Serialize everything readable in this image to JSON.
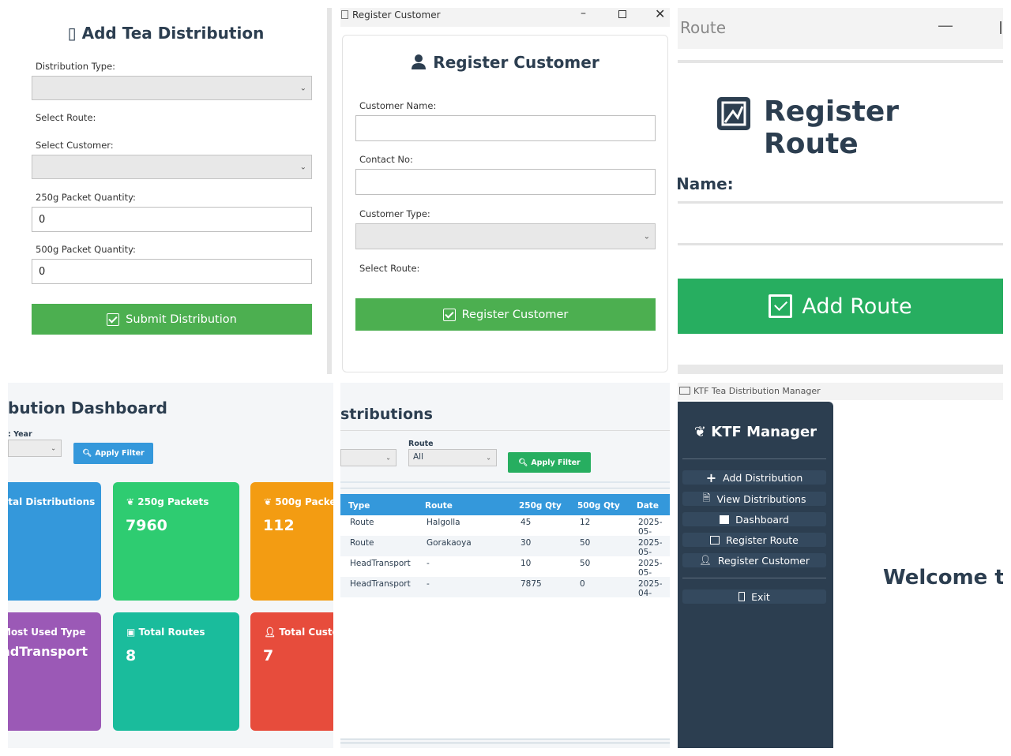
{
  "add_distribution": {
    "title": "Add Tea Distribution",
    "title_glyph": "▯",
    "distribution_type_label": "Distribution Type:",
    "distribution_type_value": "",
    "select_route_label": "Select Route:",
    "select_customer_label": "Select Customer:",
    "select_customer_value": "",
    "qty250_label": "250g Packet Quantity:",
    "qty250_value": "0",
    "qty500_label": "500g Packet Quantity:",
    "qty500_value": "0",
    "submit_label": "Submit Distribution"
  },
  "register_customer": {
    "window_title": "Register Customer",
    "title": "Register Customer",
    "customer_name_label": "Customer Name:",
    "customer_name_value": "",
    "contact_label": "Contact No:",
    "contact_value": "",
    "customer_type_label": "Customer Type:",
    "customer_type_value": "",
    "select_route_label": "Select Route:",
    "submit_label": "Register Customer"
  },
  "register_route": {
    "window_title": "Route",
    "title": "Register Route",
    "name_label": "Name:",
    "name_value": "",
    "submit_label": "Add Route"
  },
  "dashboard": {
    "title": "bution Dashboard",
    "year_label": ": Year",
    "year_value": "",
    "apply_filter_label": "Apply Filter",
    "cards": [
      {
        "title": "otal Distributions",
        "value": "",
        "color": "#3498db"
      },
      {
        "title": "250g Packets",
        "value": "7960",
        "color": "#2ecc71"
      },
      {
        "title": "500g Packe",
        "value": "112",
        "color": "#f39c12"
      },
      {
        "title": "Most Used Type",
        "value": "adTransport",
        "color": "#9b59b6"
      },
      {
        "title": "Total Routes",
        "value": "8",
        "color": "#1abc9c"
      },
      {
        "title": "Total Custo",
        "value": "7",
        "color": "#e74c3c"
      }
    ]
  },
  "distributions": {
    "title": "stributions",
    "first_filter_value": "",
    "route_label": "Route",
    "route_value": "All",
    "apply_filter_label": "Apply Filter",
    "columns": [
      "Type",
      "Route",
      "250g Qty",
      "500g Qty",
      "Date"
    ],
    "rows": [
      [
        "Route",
        "Halgolla",
        "45",
        "12",
        "2025-05-"
      ],
      [
        "Route",
        "Gorakaoya",
        "30",
        "50",
        "2025-05-"
      ],
      [
        "HeadTransport",
        "-",
        "10",
        "50",
        "2025-05-"
      ],
      [
        "HeadTransport",
        "-",
        "7875",
        "0",
        "2025-04-"
      ]
    ]
  },
  "manager": {
    "window_title": "KTF Tea Distribution Manager",
    "app_title": "KTF Manager",
    "nav": [
      {
        "label": "Add Distribution",
        "icon": "plus-icon"
      },
      {
        "label": "View Distributions",
        "icon": "document-icon"
      },
      {
        "label": "Dashboard",
        "icon": "chart-icon"
      },
      {
        "label": "Register Route",
        "icon": "map-icon"
      },
      {
        "label": "Register Customer",
        "icon": "user-icon"
      }
    ],
    "exit_label": "Exit",
    "welcome": "Welcome to",
    "sidebar_color": "#2c3e50"
  }
}
